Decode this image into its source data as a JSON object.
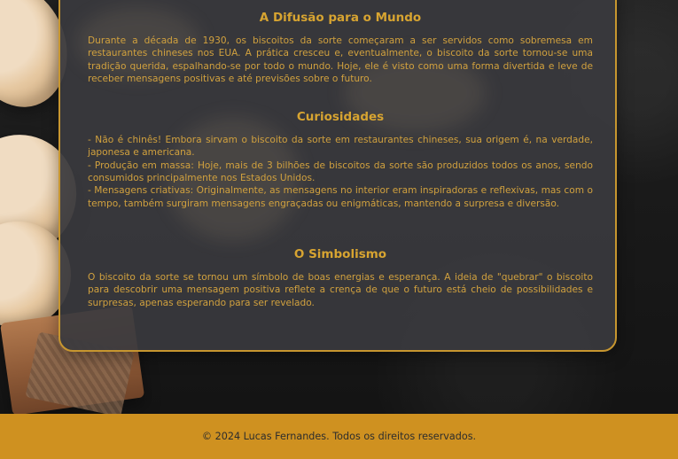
{
  "sections": {
    "difusao": {
      "title": "A Difusão para o Mundo",
      "body": "Durante a década de 1930, os biscoitos da sorte começaram a ser servidos como sobremesa em restaurantes chineses nos EUA. A prática cresceu e, eventualmente, o biscoito da sorte tornou-se uma tradição querida, espalhando-se por todo o mundo. Hoje, ele é visto como uma forma divertida e leve de receber mensagens positivas e até previsões sobre o futuro."
    },
    "curiosidades": {
      "title": "Curiosidades",
      "body": "- Não é chinês! Embora sirvam o biscoito da sorte em restaurantes chineses, sua origem é, na verdade, japonesa e americana.\n- Produção em massa: Hoje, mais de 3 bilhões de biscoitos da sorte são produzidos todos os anos, sendo consumidos principalmente nos Estados Unidos.\n- Mensagens criativas: Originalmente, as mensagens no interior eram inspiradoras e reflexivas, mas com o tempo, também surgiram mensagens engraçadas ou enigmáticas, mantendo a surpresa e diversão."
    },
    "simbolismo": {
      "title": "O Simbolismo",
      "body": "O biscoito da sorte se tornou um símbolo de boas energias e esperança. A ideia de \"quebrar\" o biscoito para descobrir uma mensagem positiva reflete a crença de que o futuro está cheio de possibilidades e surpresas, apenas esperando para ser revelado."
    }
  },
  "footer": {
    "text": "© 2024 Lucas Fernandes. Todos os direitos reservados."
  },
  "colors": {
    "accent": "#d7a431",
    "footer": "#cf9120",
    "card": "#3a3a3e"
  }
}
